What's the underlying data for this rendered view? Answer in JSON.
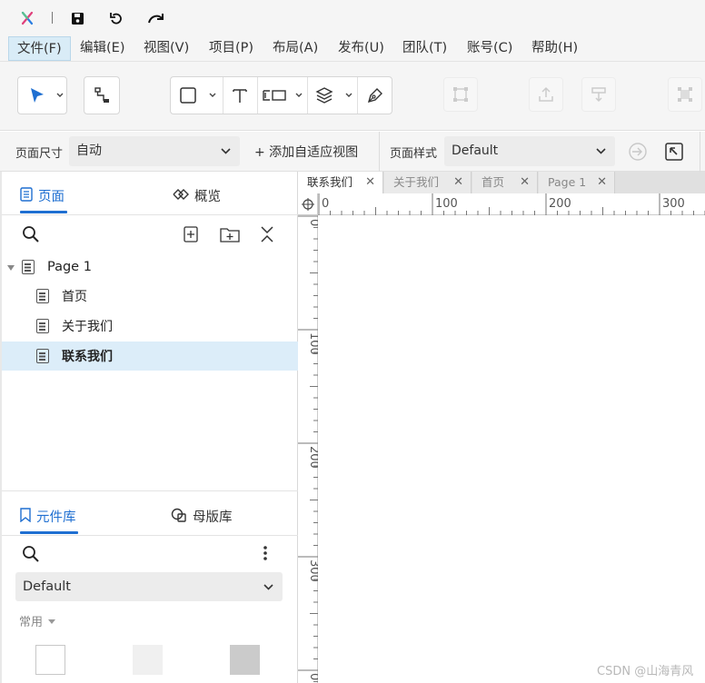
{
  "menu": {
    "items": [
      "文件(F)",
      "编辑(E)",
      "视图(V)",
      "项目(P)",
      "布局(A)",
      "发布(U)",
      "团队(T)",
      "账号(C)",
      "帮助(H)"
    ]
  },
  "pagebar": {
    "size_label": "页面尺寸",
    "size_value": "自动",
    "add_adaptive_view": "+ 添加自适应视图",
    "style_label": "页面样式",
    "style_value": "Default"
  },
  "pages_panel": {
    "tab_pages": "页面",
    "tab_outline": "概览",
    "tree": [
      {
        "label": "Page 1",
        "level": 0,
        "selected": false
      },
      {
        "label": "首页",
        "level": 1,
        "selected": false
      },
      {
        "label": "关于我们",
        "level": 1,
        "selected": false
      },
      {
        "label": "联系我们",
        "level": 1,
        "selected": true
      }
    ]
  },
  "library_panel": {
    "tab_widgets": "元件库",
    "tab_masters": "母版库",
    "library_value": "Default",
    "category": "常用"
  },
  "doc_tabs": [
    {
      "label": "联系我们",
      "active": true
    },
    {
      "label": "关于我们",
      "active": false
    },
    {
      "label": "首页",
      "active": false
    },
    {
      "label": "Page 1",
      "active": false
    }
  ],
  "rulers": {
    "h_labels": [
      "0",
      "100",
      "200",
      "300"
    ],
    "v_labels": [
      "0",
      "100",
      "200",
      "300",
      "0"
    ]
  },
  "watermark": "CSDN @山海青风",
  "colors": {
    "accent": "#1f6fd1",
    "selection": "#dcedf9"
  }
}
